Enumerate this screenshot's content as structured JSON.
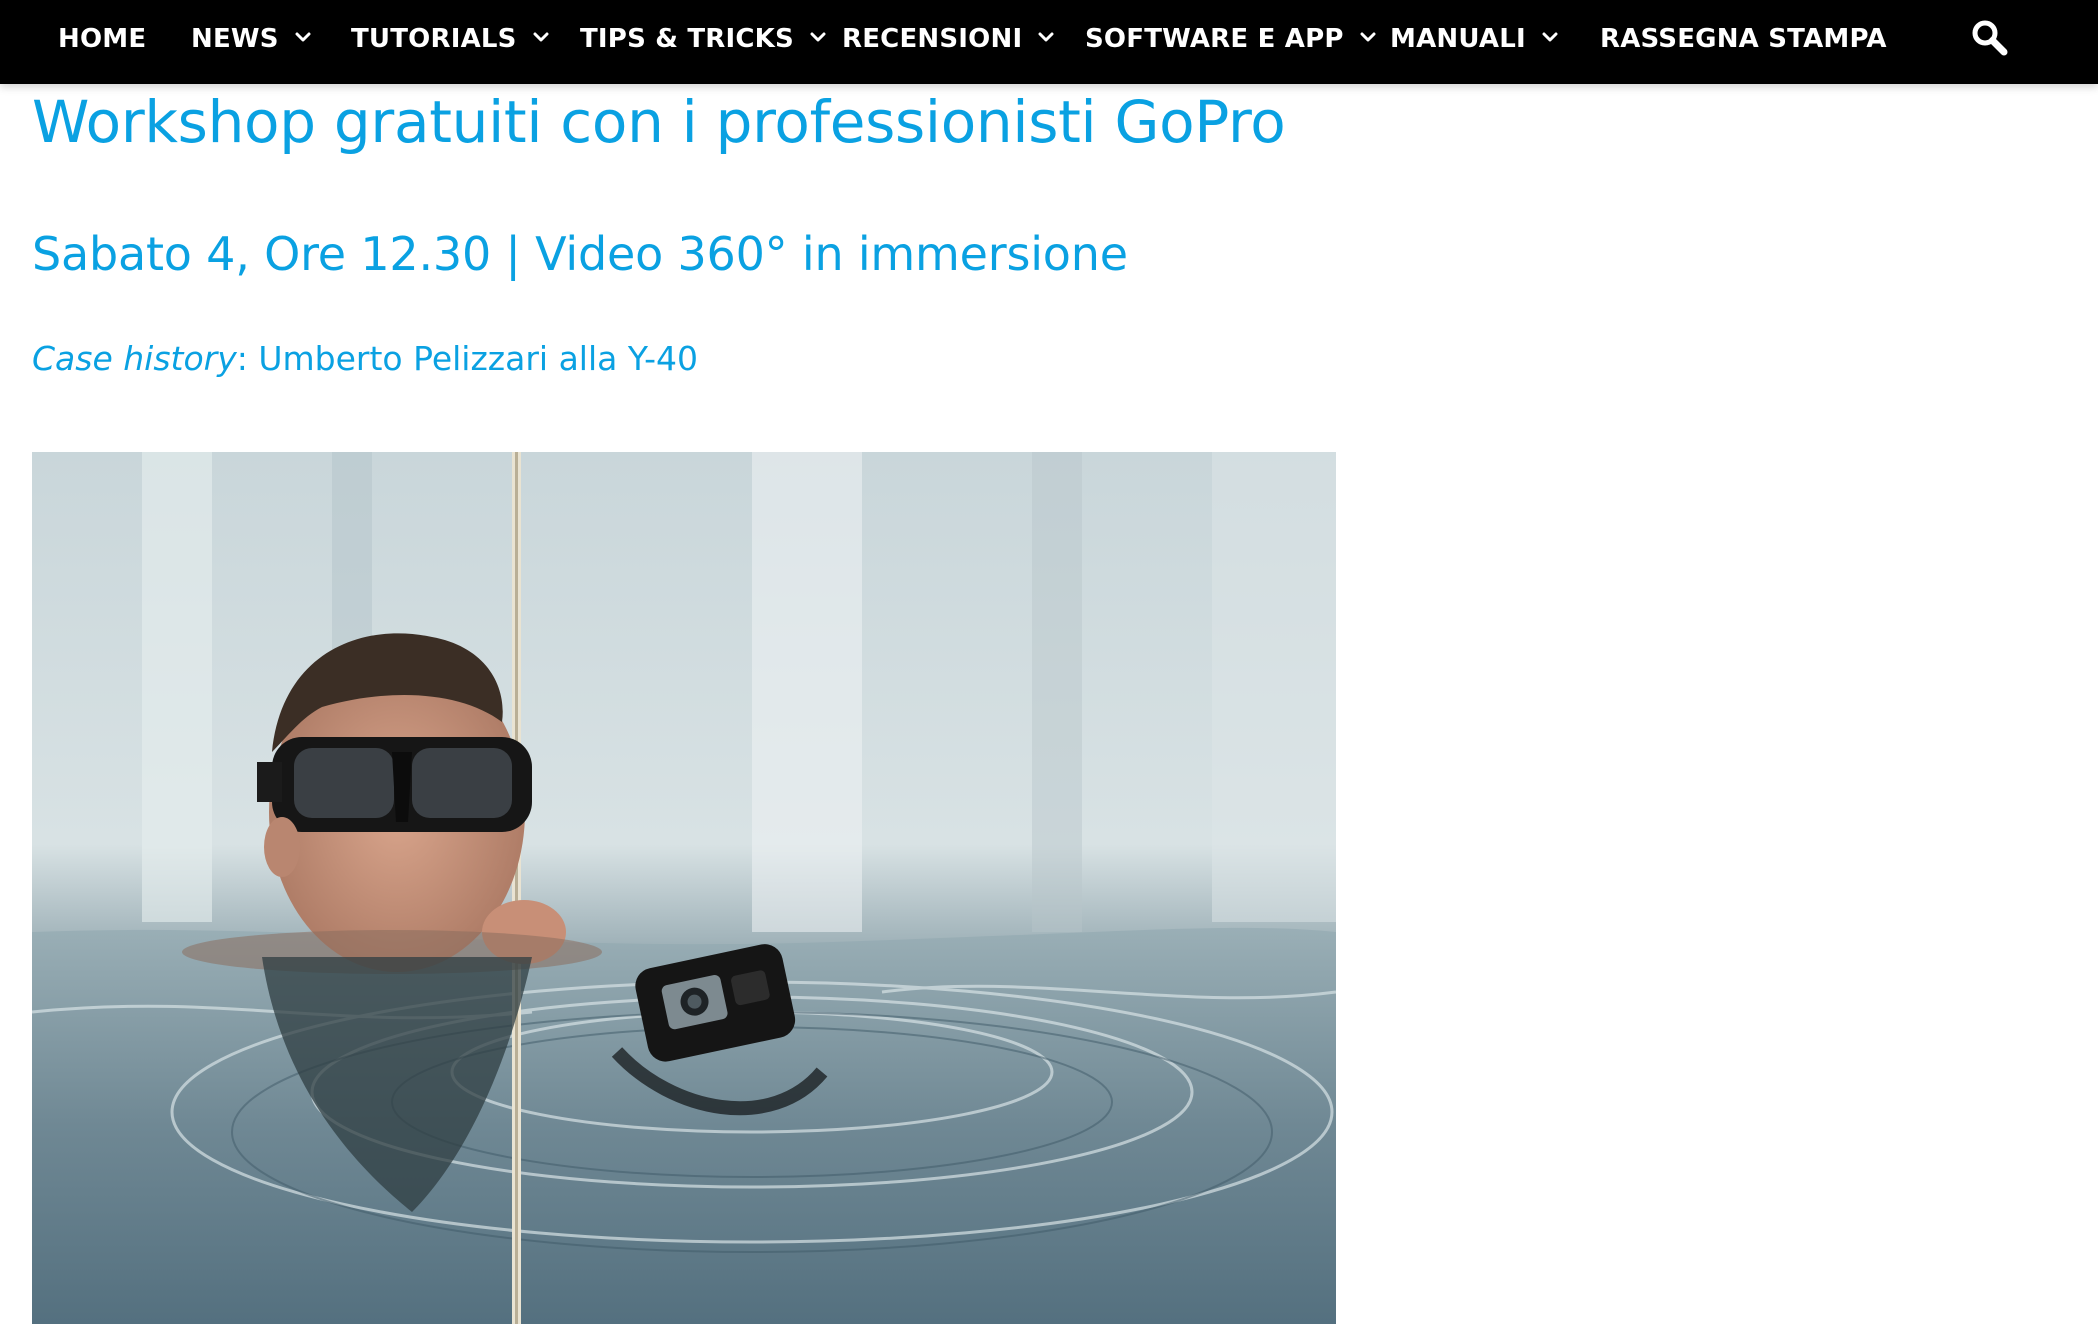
{
  "nav": {
    "items": [
      {
        "label": "HOME",
        "has_dropdown": false
      },
      {
        "label": "NEWS",
        "has_dropdown": true
      },
      {
        "label": "TUTORIALS",
        "has_dropdown": true
      },
      {
        "label": "TIPS & TRICKS",
        "has_dropdown": true
      },
      {
        "label": "RECENSIONI",
        "has_dropdown": true
      },
      {
        "label": "SOFTWARE E APP",
        "has_dropdown": true
      },
      {
        "label": "MANUALI",
        "has_dropdown": true
      },
      {
        "label": "RASSEGNA STAMPA",
        "has_dropdown": false
      }
    ],
    "search_icon": "search-icon",
    "dropdown_icon": "chevron-down-icon"
  },
  "article": {
    "title": "Workshop gratuiti con i professionisti GoPro",
    "subtitle": "Sabato 4, Ore 12.30 | Video 360° in immersione",
    "case_history_label": "Case history",
    "case_history_text": ": Umberto Pelizzari alla Y-40"
  },
  "colors": {
    "nav_background": "#000000",
    "nav_text": "#ffffff",
    "accent": "#0aa1e2",
    "background": "#ffffff"
  }
}
